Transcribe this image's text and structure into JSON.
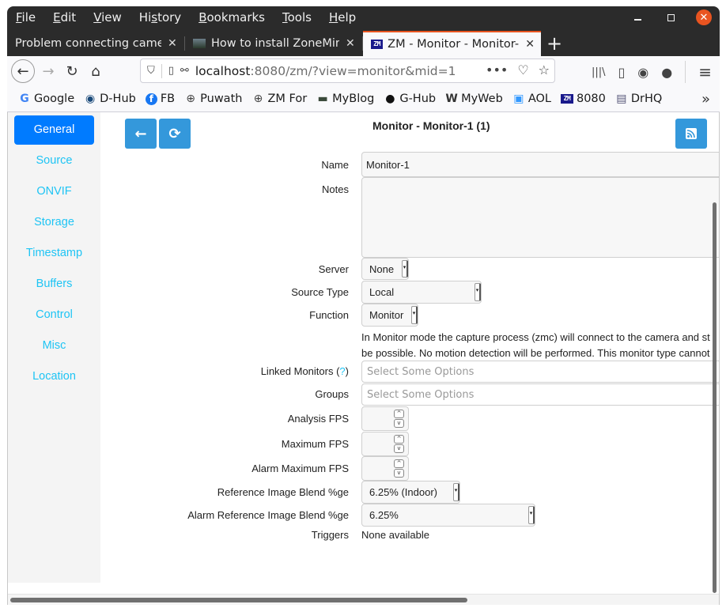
{
  "menu": {
    "items": [
      {
        "pre": "",
        "key": "F",
        "post": "ile"
      },
      {
        "pre": "",
        "key": "E",
        "post": "dit"
      },
      {
        "pre": "",
        "key": "V",
        "post": "iew"
      },
      {
        "pre": "Hi",
        "key": "s",
        "post": "tory"
      },
      {
        "pre": "",
        "key": "B",
        "post": "ookmarks"
      },
      {
        "pre": "",
        "key": "T",
        "post": "ools"
      },
      {
        "pre": "",
        "key": "H",
        "post": "elp"
      }
    ]
  },
  "window_controls": {
    "minimize": "minimize",
    "maximize": "maximize",
    "close": "✕"
  },
  "tabs": [
    {
      "title": "Problem connecting camera",
      "close": "✕",
      "active": false
    },
    {
      "title": "How to install ZoneMinder",
      "close": "✕",
      "active": false
    },
    {
      "title": "ZM - Monitor - Monitor-1",
      "close": "✕",
      "active": true,
      "favicon": "ZM"
    }
  ],
  "new_tab": "+",
  "nav": {
    "back": "←",
    "forward": "→",
    "reload": "↻",
    "home": "⌂",
    "url_host": "localhost",
    "url_rest": ":8080/zm/?view=monitor&mid=1",
    "url_more": "•••",
    "pocket": "♡",
    "star": "☆",
    "library": "|||\\",
    "sidebar": "▯",
    "account": "◉",
    "extension": "●",
    "menu": "≡"
  },
  "bookmarks": [
    {
      "label": "Google",
      "icon": "G",
      "color": "#4285f4"
    },
    {
      "label": "D-Hub",
      "icon": "◉",
      "color": "#1a4a7a"
    },
    {
      "label": "FB",
      "icon": "f",
      "color": "#1877f2"
    },
    {
      "label": "Puwath",
      "icon": "⊕",
      "color": "#444"
    },
    {
      "label": "ZM For",
      "icon": "⊕",
      "color": "#444"
    },
    {
      "label": "MyBlog",
      "icon": "▬",
      "color": "#3a4a3a"
    },
    {
      "label": "G-Hub",
      "icon": "●",
      "color": "#111"
    },
    {
      "label": "MyWeb",
      "icon": "W",
      "color": "#333"
    },
    {
      "label": "AOL",
      "icon": "▣",
      "color": "#39f"
    },
    {
      "label": "8080",
      "icon": "ZM",
      "color": "#1a1a8c"
    },
    {
      "label": "DrHQ",
      "icon": "▤",
      "color": "#557"
    }
  ],
  "bookmarks_more": "»",
  "sidebar": {
    "items": [
      {
        "label": "General",
        "active": true
      },
      {
        "label": "Source"
      },
      {
        "label": "ONVIF"
      },
      {
        "label": "Storage"
      },
      {
        "label": "Timestamp"
      },
      {
        "label": "Buffers"
      },
      {
        "label": "Control"
      },
      {
        "label": "Misc"
      },
      {
        "label": "Location"
      }
    ]
  },
  "toolbar": {
    "back": "←",
    "refresh": "⟳",
    "feed": "⌇"
  },
  "page": {
    "title": "Monitor - Monitor-1 (1)"
  },
  "form": {
    "name_label": "Name",
    "name_value": "Monitor-1",
    "notes_label": "Notes",
    "notes_value": "",
    "server_label": "Server",
    "server_value": "None",
    "source_type_label": "Source Type",
    "source_type_value": "Local",
    "function_label": "Function",
    "function_value": "Monitor",
    "function_help_1": "In Monitor mode the capture process (zmc) will connect to the camera and st",
    "function_help_2": "be possible. No motion detection will be performed. This monitor type cannot",
    "linked_label": "Linked Monitors (",
    "linked_q": "?",
    "linked_close": ")",
    "linked_placeholder": "Select Some Options",
    "groups_label": "Groups",
    "groups_placeholder": "Select Some Options",
    "analysis_fps_label": "Analysis FPS",
    "analysis_fps_value": "",
    "max_fps_label": "Maximum FPS",
    "max_fps_value": "",
    "alarm_max_fps_label": "Alarm Maximum FPS",
    "alarm_max_fps_value": "",
    "ref_blend_label": "Reference Image Blend %ge",
    "ref_blend_value": "6.25% (Indoor)",
    "alarm_ref_blend_label": "Alarm Reference Image Blend %ge",
    "alarm_ref_blend_value": "6.25%",
    "triggers_label": "Triggers",
    "triggers_value": "None available",
    "spin_up": "^",
    "spin_down": "v",
    "select_arrow": "▾"
  }
}
